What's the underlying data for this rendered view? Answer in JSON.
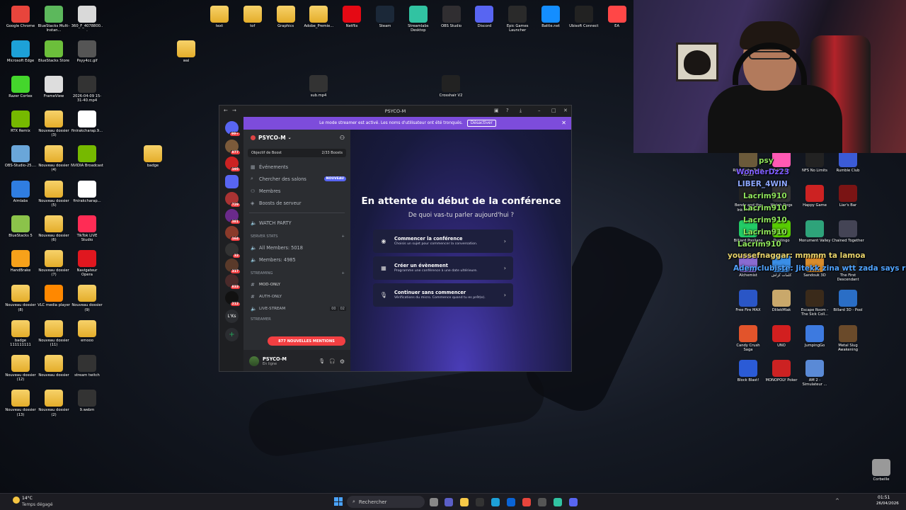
{
  "desktop": {
    "left_icons": [
      {
        "label": "Google Chrome",
        "color": "#e8453c"
      },
      {
        "label": "BlueStacks Multi-Instan...",
        "color": "#5cb85c"
      },
      {
        "label": "360_F_4078800...",
        "color": "#d9d9d9"
      },
      {
        "label": "Microsoft Edge",
        "color": "#1da1d8"
      },
      {
        "label": "BlueStacks Store",
        "color": "#6cbf3b"
      },
      {
        "label": "Psyy4cc.gif",
        "color": "#555"
      },
      {
        "label": "Razer Cortex",
        "color": "#44d62c"
      },
      {
        "label": "FrameView",
        "color": "#ddd"
      },
      {
        "label": "2026-04-09 15-31-40.mp4",
        "color": "#333"
      },
      {
        "label": "RTX Remix",
        "color": "#76b900"
      },
      {
        "label": "Nouveau dossier (3)",
        "color": "folder"
      },
      {
        "label": "finirakcharap.9...",
        "color": "#fff"
      },
      {
        "label": "OBS-Studio-25....",
        "color": "#6aa6d9"
      },
      {
        "label": "Nouveau dossier (4)",
        "color": "folder"
      },
      {
        "label": "NVIDIA Broadcast",
        "color": "#76b900"
      },
      {
        "label": "Aimlabs",
        "color": "#2f7de1"
      },
      {
        "label": "Nouveau dossier (5)",
        "color": "folder"
      },
      {
        "label": "finirakcharap...",
        "color": "#fff"
      },
      {
        "label": "BlueStacks 5",
        "color": "#8bc34a"
      },
      {
        "label": "Nouveau dossier (6)",
        "color": "folder"
      },
      {
        "label": "TikTok LIVE Studio",
        "color": "#ff2c55"
      },
      {
        "label": "HandBrake",
        "color": "#f7a11a"
      },
      {
        "label": "Nouveau dossier (7)",
        "color": "folder"
      },
      {
        "label": "Navigateur Opera",
        "color": "#e0171f"
      },
      {
        "label": "Nouveau dossier (8)",
        "color": "folder"
      },
      {
        "label": "VLC media player",
        "color": "#ff8800"
      },
      {
        "label": "Nouveau dossier (9)",
        "color": "folder"
      },
      {
        "label": "badge 111111111",
        "color": "folder"
      },
      {
        "label": "Nouveau dossier (11)",
        "color": "folder"
      },
      {
        "label": "emooo",
        "color": "folder"
      },
      {
        "label": "Nouveau dossier (12)",
        "color": "folder"
      },
      {
        "label": "Nouveau dossier",
        "color": "folder"
      },
      {
        "label": "stream twitch",
        "color": "#333"
      },
      {
        "label": "Nouveau dossier (13)",
        "color": "folder"
      },
      {
        "label": "Nouveau dossier (2)",
        "color": "folder"
      },
      {
        "label": "9.webm",
        "color": "#333"
      }
    ],
    "top_icons": [
      {
        "label": "text",
        "color": "folder"
      },
      {
        "label": "tof",
        "color": "folder"
      },
      {
        "label": "Graphics",
        "color": "folder"
      },
      {
        "label": "Adobe_Premie...",
        "color": "folder"
      },
      {
        "label": "Netflix",
        "color": "#e50914"
      },
      {
        "label": "Steam",
        "color": "#1b2838"
      },
      {
        "label": "Streamlabs Desktop",
        "color": "#31c3a2"
      },
      {
        "label": "OBS Studio",
        "color": "#302e31"
      },
      {
        "label": "Discord",
        "color": "#5865f2"
      },
      {
        "label": "Epic Games Launcher",
        "color": "#2a2a2a"
      },
      {
        "label": "Battle.net",
        "color": "#148eff"
      },
      {
        "label": "Ubisoft Connect",
        "color": "#222"
      },
      {
        "label": "EA",
        "color": "#ff4747"
      }
    ],
    "misc_icons": [
      {
        "label": "wal",
        "color": "folder"
      },
      {
        "label": "sub.mp4",
        "color": "#333"
      },
      {
        "label": "Crosshair V2",
        "color": "#222"
      },
      {
        "label": "badge",
        "color": "folder"
      }
    ],
    "right_icons": [
      {
        "label": "Rise of the Tomb Raider",
        "color": "#6b5a3a"
      },
      {
        "label": "Fall Guys",
        "color": "#ff5ab4"
      },
      {
        "label": "NFS No Limits",
        "color": "#222"
      },
      {
        "label": "Rumble Club",
        "color": "#3b5bd6"
      },
      {
        "label": "Bendy and the Ink Machine",
        "color": "#222"
      },
      {
        "label": "Watch Dogs",
        "color": "#333"
      },
      {
        "label": "Happy Game",
        "color": "#c22"
      },
      {
        "label": "Liar's Bar",
        "color": "#7a1414"
      },
      {
        "label": "Billiard Poolians",
        "color": "#2c6"
      },
      {
        "label": "Duolingo",
        "color": "#58cc02"
      },
      {
        "label": "Monument Valley",
        "color": "#2ea37a"
      },
      {
        "label": "Chained Together",
        "color": "#445"
      },
      {
        "label": "Alchemist",
        "color": "#8a6bd1"
      },
      {
        "label": "كلمات كراش",
        "color": "#3a8ee6"
      },
      {
        "label": "Sandouk 3D",
        "color": "#d98c2b"
      },
      {
        "label": "The First Descendant",
        "color": "#222"
      },
      {
        "label": "Free Fire MAX",
        "color": "#2a56c6"
      },
      {
        "label": "DlilekMlak",
        "color": "#c9a86b"
      },
      {
        "label": "Escape Room - The Sick Coll...",
        "color": "#3a2a1a"
      },
      {
        "label": "Billard 3D - Pool",
        "color": "#2a6ec6"
      },
      {
        "label": "Candy Crush Saga",
        "color": "#e2542b"
      },
      {
        "label": "UNO",
        "color": "#d21f1f"
      },
      {
        "label": "JumpingGo",
        "color": "#3d7ae0"
      },
      {
        "label": "Metal Slug Awakening",
        "color": "#6a4a2a"
      },
      {
        "label": "Block Blast!",
        "color": "#2b5bd6"
      },
      {
        "label": "MONOPOLY Poker",
        "color": "#c22"
      },
      {
        "label": "AM 2 - Simulateur ...",
        "color": "#5a8ad6"
      },
      {
        "label": "Corbeille",
        "color": "#999"
      }
    ]
  },
  "chat_overlay": [
    {
      "text": "psy",
      "color": "#8ee35b"
    },
    {
      "text": "WonderDz23",
      "color": "#7d5cff"
    },
    {
      "text": "LIBER_4WIN",
      "color": "#8ea8ff"
    },
    {
      "text": "Lacrim910",
      "color": "#8ee35b"
    },
    {
      "text": "Lacrim910",
      "color": "#8ee35b"
    },
    {
      "text": "Lacrim910",
      "color": "#8ee35b"
    },
    {
      "text": "Lacrim910",
      "color": "#8ee35b"
    },
    {
      "text": "Lacrim910",
      "color": "#8ee35b"
    },
    {
      "text": "youssefnaggar: mmmm ta lamoa",
      "color": "#e8d36b"
    },
    {
      "text": "Ademclubiste: Jitekk zina wtt zada says rouhkk",
      "color": "#4fa3ff"
    }
  ],
  "discord": {
    "title": "PSYCO-M",
    "banner": {
      "text": "Le mode streamer est activé. Les noms d'utilisateur ont été tronqués.",
      "button": "Désactiver"
    },
    "guild_badges": [
      "99+",
      "877",
      "195",
      "729",
      "381",
      "164",
      "32",
      "317",
      "833",
      "212",
      "L'Ks"
    ],
    "server_name": "PSYCO-M",
    "boost": {
      "label": "Objectif de Boost",
      "value": "2/33 Boosts"
    },
    "menu": [
      {
        "icon": "calendar-icon",
        "label": "Événements"
      },
      {
        "icon": "search-icon",
        "label": "Chercher des salons",
        "badge": "NOUVEAU"
      },
      {
        "icon": "members-icon",
        "label": "Membres"
      },
      {
        "icon": "boost-icon",
        "label": "Boosts de serveur"
      }
    ],
    "channels": [
      {
        "type": "voice",
        "label": "WATCH PARTY"
      },
      {
        "type": "category",
        "label": "SERVER STATS"
      },
      {
        "type": "voice",
        "label": "All Members: 5018"
      },
      {
        "type": "voice",
        "label": "Members: 4985"
      },
      {
        "type": "category",
        "label": "STREAMING"
      },
      {
        "type": "text",
        "label": "MOD-ONLY"
      },
      {
        "type": "text",
        "label": "AUTH-ONLY"
      },
      {
        "type": "voice",
        "label": "LIVE-STREAM"
      },
      {
        "type": "category",
        "label": "STREAMER"
      }
    ],
    "live_counts": [
      "00",
      "02"
    ],
    "mentions": "877 NOUVELLES MENTIONS",
    "user": {
      "name": "PSYCO-M",
      "status": "En ligne"
    },
    "stage": {
      "title": "En attente du début de la conférence",
      "subtitle": "De quoi vas-tu parler aujourd'hui ?",
      "options": [
        {
          "title": "Commencer la conférence",
          "desc": "Choisis un sujet pour commencer la conversation."
        },
        {
          "title": "Créer un évènement",
          "desc": "Programme une conférence à une date ultérieure."
        },
        {
          "title": "Continuer sans commencer",
          "desc": "Vérifications du micro. Commence quand tu es prêt(e)."
        }
      ]
    }
  },
  "taskbar": {
    "weather": {
      "temp": "14°C",
      "desc": "Temps dégagé"
    },
    "search_placeholder": "Rechercher",
    "time": "01:51",
    "date": "26/04/2026"
  }
}
